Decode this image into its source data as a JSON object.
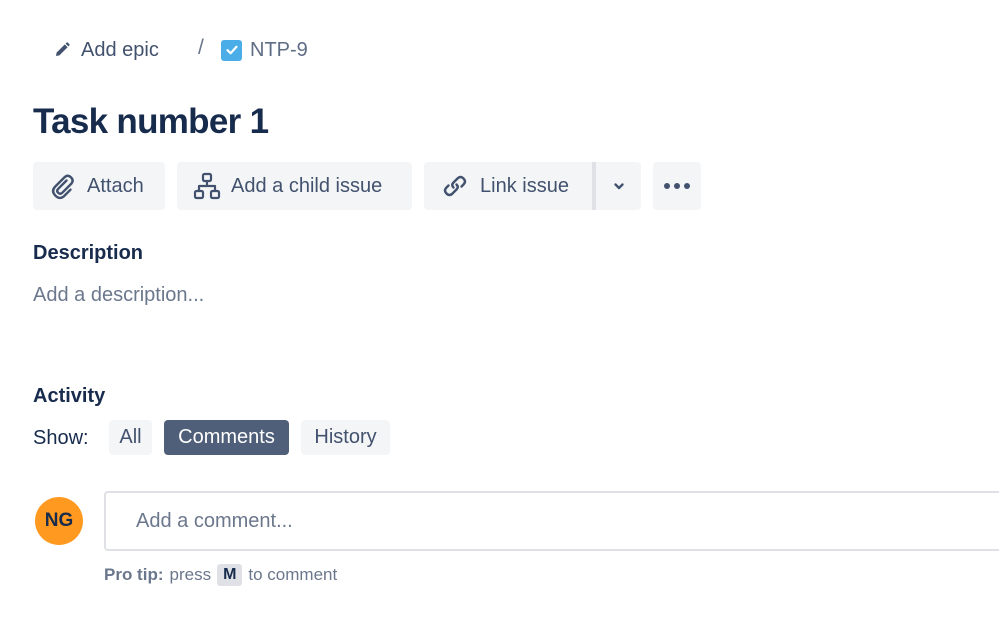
{
  "breadcrumb": {
    "epic_label": "Add epic",
    "separator": "/",
    "issue_key": "NTP-9"
  },
  "issue": {
    "title": "Task number 1"
  },
  "toolbar": {
    "attach_label": "Attach",
    "child_issue_label": "Add a child issue",
    "link_issue_label": "Link issue"
  },
  "description": {
    "heading": "Description",
    "placeholder": "Add a description..."
  },
  "activity": {
    "heading": "Activity",
    "show_label": "Show:",
    "filters": [
      {
        "label": "All",
        "selected": false
      },
      {
        "label": "Comments",
        "selected": true
      },
      {
        "label": "History",
        "selected": false
      }
    ]
  },
  "comment": {
    "avatar_initials": "NG",
    "placeholder": "Add a comment...",
    "protip_label": "Pro tip:",
    "protip_press": "press",
    "protip_key": "M",
    "protip_suffix": "to comment"
  },
  "colors": {
    "accent_selected": "#505f79",
    "avatar_bg": "#ff991f",
    "task_icon": "#4bade8",
    "text_primary": "#172b4d",
    "text_subtle": "#6b778c"
  },
  "icons": {
    "epic": "pencil-icon",
    "task_type": "checkbox-icon",
    "attach": "paperclip-icon",
    "child_issue": "hierarchy-icon",
    "link": "link-icon",
    "dropdown": "chevron-down-icon",
    "more": "more-icon"
  }
}
